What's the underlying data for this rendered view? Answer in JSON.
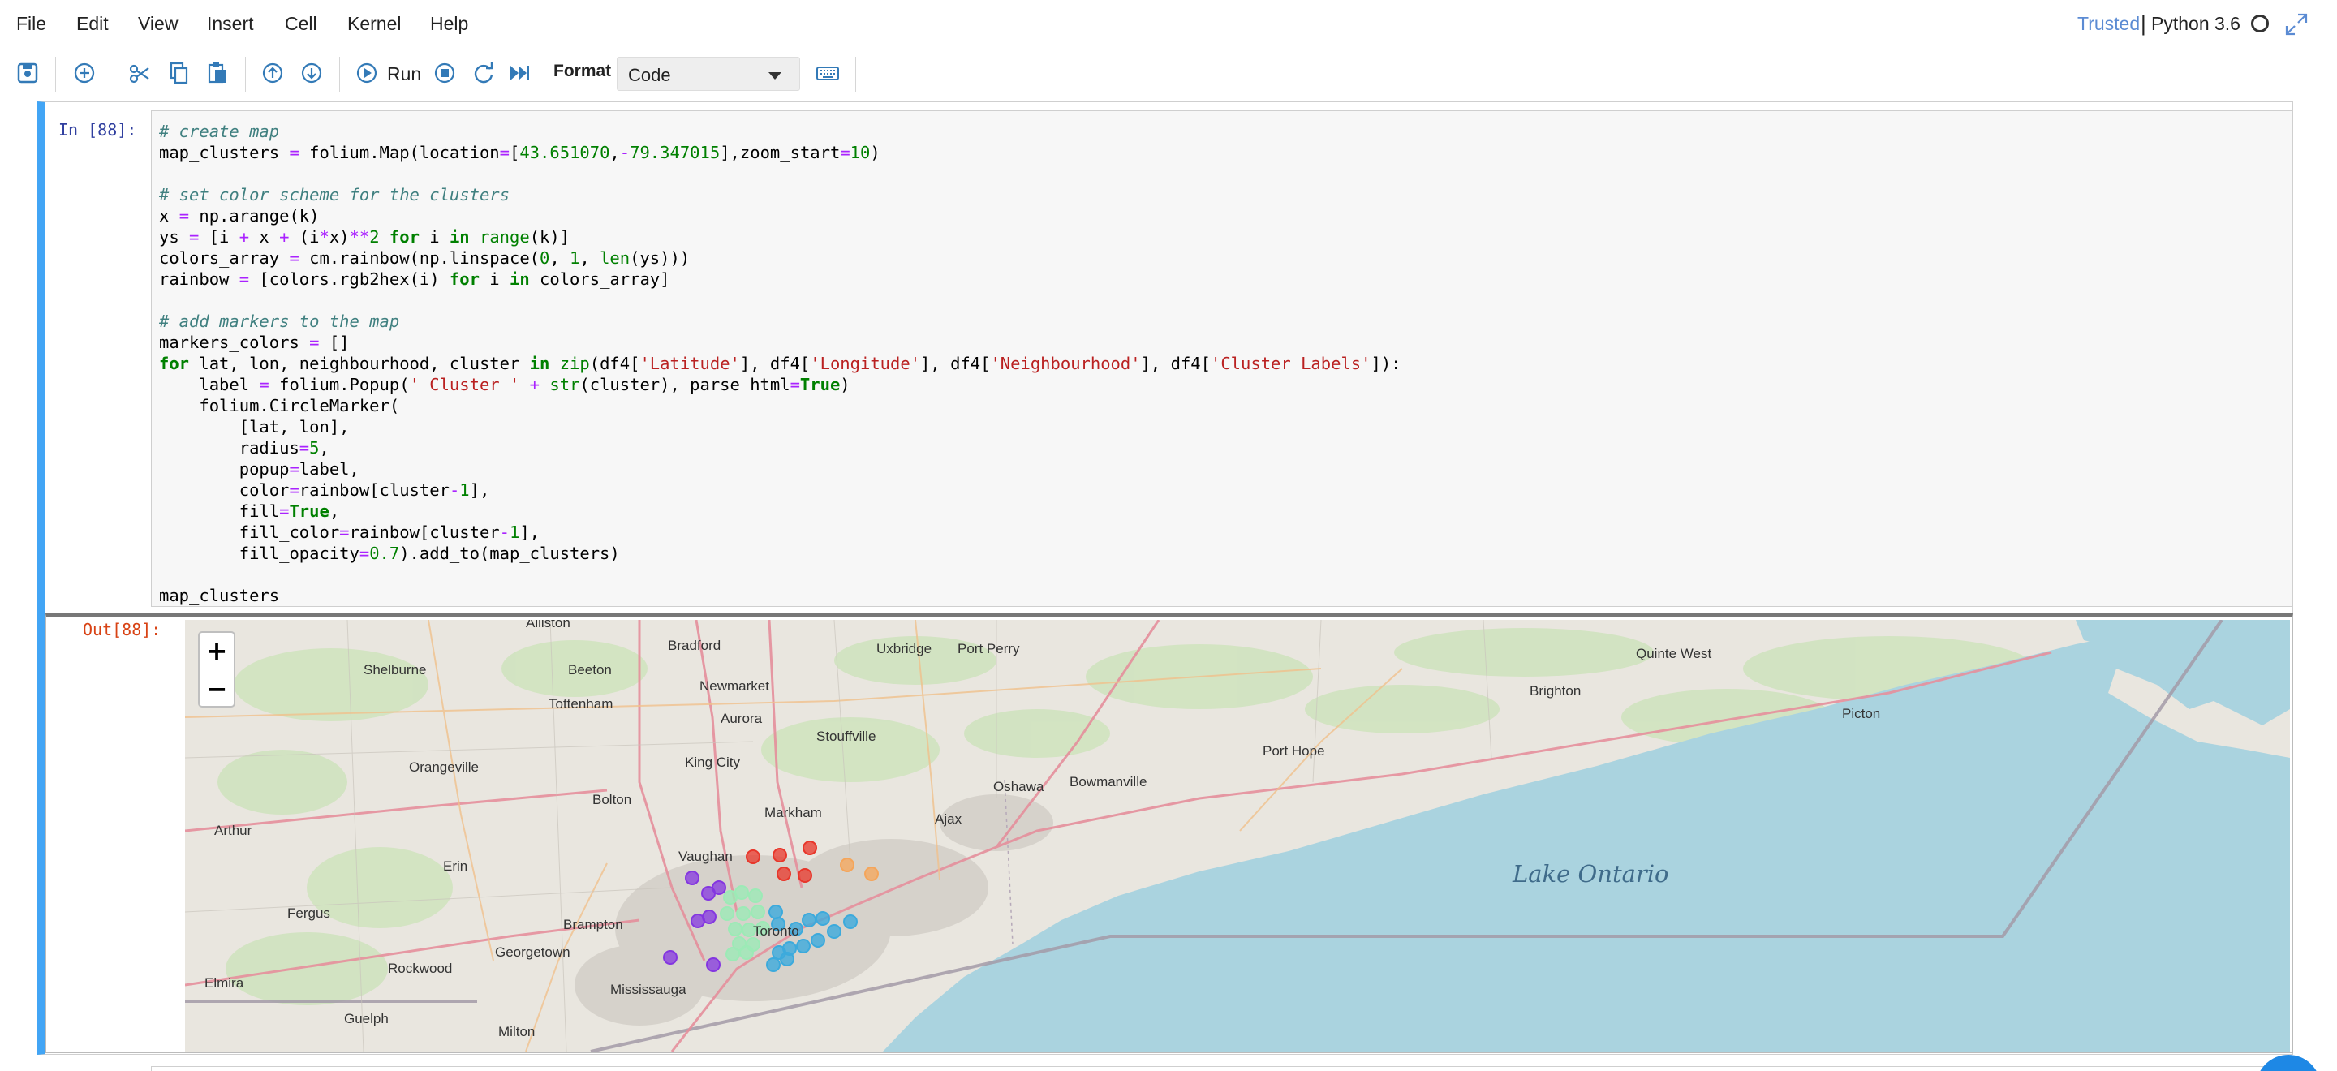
{
  "menubar": {
    "items": [
      "File",
      "Edit",
      "View",
      "Insert",
      "Cell",
      "Kernel",
      "Help"
    ],
    "trusted": "Trusted",
    "separator": "|",
    "kernel": "Python 3.6"
  },
  "toolbar": {
    "run_label": "Run",
    "format_label": "Format",
    "cell_type": "Code",
    "icons": [
      "save-icon",
      "add-cell-icon",
      "cut-icon",
      "copy-icon",
      "paste-icon",
      "move-up-icon",
      "move-down-icon",
      "run-icon",
      "stop-icon",
      "restart-icon",
      "fast-forward-icon",
      "keyboard-icon"
    ]
  },
  "cell": {
    "in_prompt": "In [88]:",
    "out_prompt": "Out[88]:"
  },
  "map": {
    "zoom_in": "+",
    "zoom_out": "−",
    "lake": "Lake Ontario",
    "places": [
      "Alliston",
      "Bradford",
      "Uxbridge",
      "Port Perry",
      "Quinte West",
      "Shelburne",
      "Beeton",
      "Newmarket",
      "Tottenham",
      "Brighton",
      "Picton",
      "Aurora",
      "Stouffville",
      "Orangeville",
      "King City",
      "Oshawa",
      "Bowmanville",
      "Port Hope",
      "Bolton",
      "Markham",
      "Ajax",
      "Arthur",
      "Vaughan",
      "Erin",
      "Fergus",
      "Georgetown",
      "Brampton",
      "Rockwood",
      "Elmira",
      "Mississauga",
      "Guelph",
      "Milton",
      "Toronto"
    ],
    "colors": {
      "water": "#aad3df",
      "land": "#e9e6df",
      "cluster_red": "#e8362a",
      "cluster_purple": "#8436e0",
      "cluster_green": "#9ceab6",
      "cluster_blue": "#3caadc",
      "cluster_orange": "#f5a55a"
    }
  }
}
